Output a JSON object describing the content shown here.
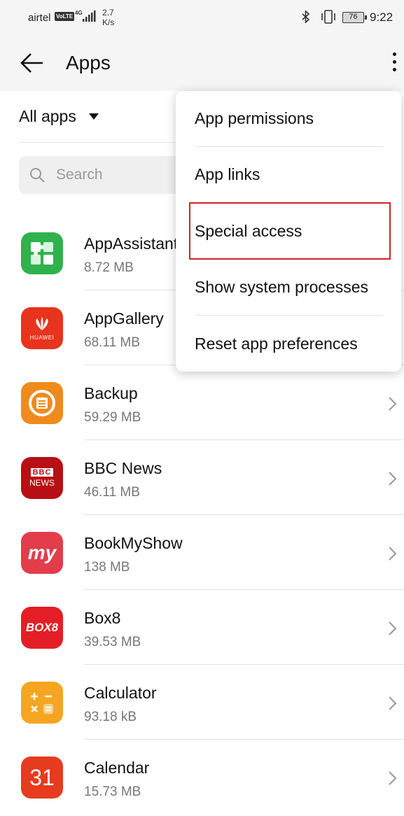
{
  "status_bar": {
    "carrier": "airtel",
    "volte": "VoLTE",
    "network": "4G",
    "speed_value": "2.7",
    "speed_unit": "K/s",
    "battery": "76",
    "time": "9:22"
  },
  "header": {
    "title": "Apps",
    "back_icon": "arrow-left-icon",
    "more_icon": "more-vertical-icon"
  },
  "filter": {
    "label": "All apps"
  },
  "search": {
    "placeholder": "Search"
  },
  "apps": [
    {
      "name": "AppAssistant",
      "size": "8.72 MB",
      "icon": "puzzle-icon",
      "color": "#2fb24c"
    },
    {
      "name": "AppGallery",
      "size": "68.11 MB",
      "icon": "huawei-icon",
      "color": "#e8331d"
    },
    {
      "name": "Backup",
      "size": "59.29 MB",
      "icon": "backup-icon",
      "color": "#f08a1c"
    },
    {
      "name": "BBC News",
      "size": "46.11 MB",
      "icon": "bbc-news-icon",
      "color": "#b70f14"
    },
    {
      "name": "BookMyShow",
      "size": "138 MB",
      "icon": "bookmyshow-icon",
      "color": "#e33c4b"
    },
    {
      "name": "Box8",
      "size": "39.53 MB",
      "icon": "box8-icon",
      "color": "#e41e26"
    },
    {
      "name": "Calculator",
      "size": "93.18 kB",
      "icon": "calculator-icon",
      "color": "#f6a521"
    },
    {
      "name": "Calendar",
      "size": "15.73 MB",
      "icon": "calendar-icon",
      "color": "#e63b1f"
    }
  ],
  "app_icon_text": {
    "appgallery": "HUAWEI",
    "bbc_top": "BBC",
    "bbc_bottom": "NEWS",
    "bookmyshow": "my",
    "box8": "BOX8",
    "calendar": "31"
  },
  "menu": {
    "items": [
      {
        "label": "App permissions"
      },
      {
        "label": "App links"
      },
      {
        "label": "Special access"
      },
      {
        "label": "Show system processes"
      },
      {
        "label": "Reset app preferences"
      }
    ],
    "highlighted": "Special access",
    "highlight_color": "#d2232a"
  }
}
